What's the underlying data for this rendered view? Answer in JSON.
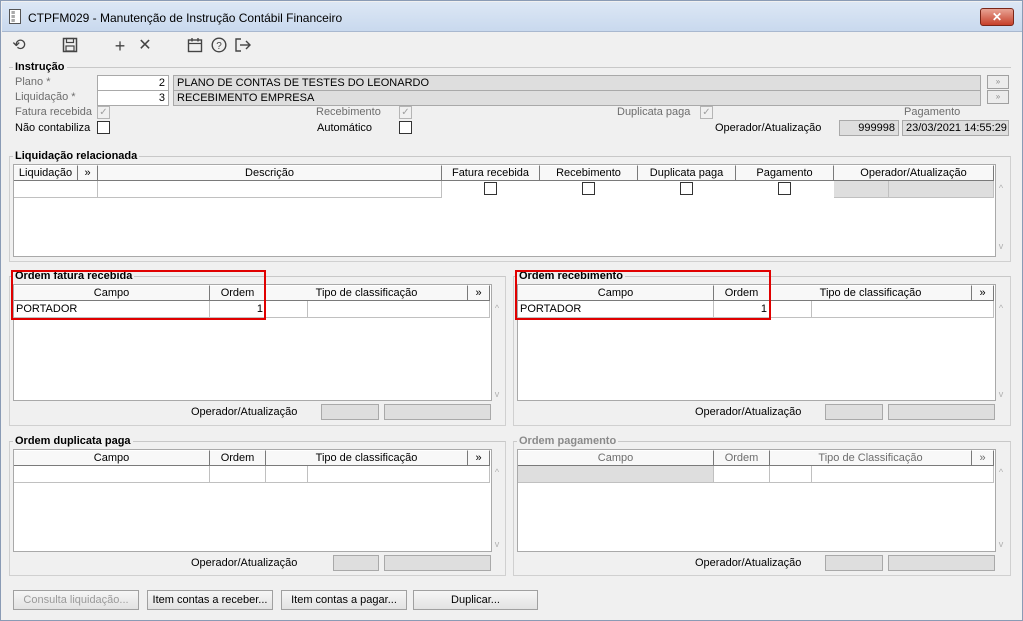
{
  "window": {
    "title": "CTPFM029 - Manutenção de Instrução Contábil Financeiro",
    "close_label": "✕"
  },
  "toolbar": {
    "icons": [
      "undo-icon",
      "save-icon",
      "add-icon",
      "delete-icon",
      "calendar-icon",
      "help-icon",
      "exit-icon"
    ]
  },
  "instrucao": {
    "title": "Instrução",
    "plano_label": "Plano *",
    "plano_value": "2",
    "plano_desc": "PLANO DE CONTAS DE TESTES DO LEONARDO",
    "liquidacao_label": "Liquidação *",
    "liquidacao_value": "3",
    "liquidacao_desc": "RECEBIMENTO EMPRESA",
    "fatura_recebida_label": "Fatura recebida",
    "recebimento_label": "Recebimento",
    "duplicata_paga_label": "Duplicata paga",
    "pagamento_label": "Pagamento",
    "nao_contabiliza_label": "Não contabiliza",
    "automatico_label": "Automático",
    "operador_label": "Operador/Atualização",
    "operador_value": "999998",
    "atualizacao_value": "23/03/2021 14:55:29"
  },
  "liquidacao_relacionada": {
    "title": "Liquidação relacionada",
    "columns": [
      "Liquidação",
      "»",
      "Descrição",
      "Fatura recebida",
      "Recebimento",
      "Duplicata paga",
      "Pagamento",
      "Operador/Atualização"
    ]
  },
  "ordem_fatura": {
    "title": "Ordem fatura recebida",
    "columns": [
      "Campo",
      "Ordem",
      "Tipo de classificação",
      "»"
    ],
    "rows": [
      {
        "campo": "PORTADOR",
        "ordem": "1"
      }
    ],
    "operador_label": "Operador/Atualização"
  },
  "ordem_recebimento": {
    "title": "Ordem recebimento",
    "columns": [
      "Campo",
      "Ordem",
      "Tipo de classificação",
      "»"
    ],
    "rows": [
      {
        "campo": "PORTADOR",
        "ordem": "1"
      }
    ],
    "operador_label": "Operador/Atualização"
  },
  "ordem_duplicata": {
    "title": "Ordem duplicata paga",
    "columns": [
      "Campo",
      "Ordem",
      "Tipo de classificação",
      "»"
    ],
    "operador_label": "Operador/Atualização"
  },
  "ordem_pagamento": {
    "title": "Ordem pagamento",
    "columns": [
      "Campo",
      "Ordem",
      "Tipo de Classificação",
      "»"
    ],
    "operador_label": "Operador/Atualização"
  },
  "buttons": {
    "consulta": "Consulta liquidação...",
    "contas_receber": "Item contas a receber...",
    "contas_pagar": "Item contas a pagar...",
    "duplicar": "Duplicar..."
  },
  "colors": {
    "highlight": "#e00000",
    "title_bar": "#c9d9ee"
  }
}
